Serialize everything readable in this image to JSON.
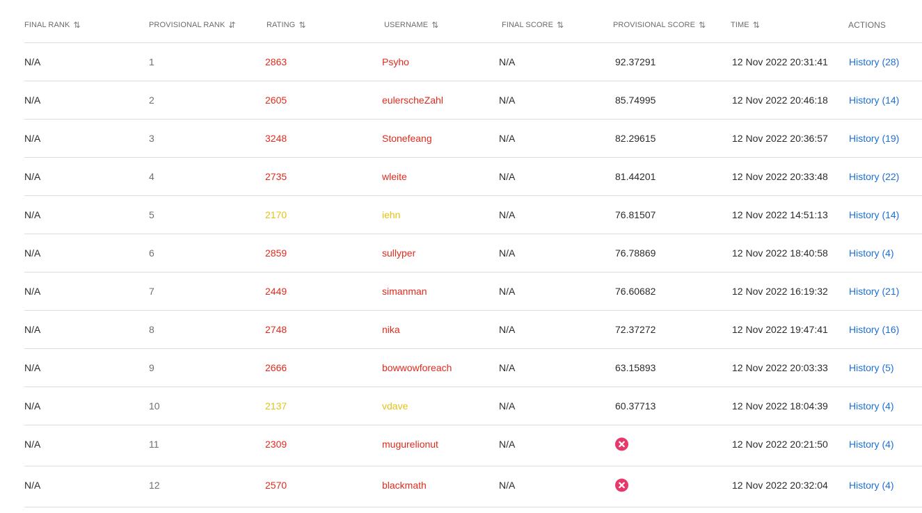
{
  "columns": {
    "final_rank": "FINAL RANK",
    "provisional_rank": "PROVISIONAL RANK",
    "rating": "RATING",
    "username": "USERNAME",
    "final_score": "FINAL SCORE",
    "provisional_score": "PROVISIONAL SCORE",
    "time": "TIME",
    "actions": "ACTIONS"
  },
  "sort_icons": {
    "default": "⇅",
    "provisional_rank": "⇵"
  },
  "colors": {
    "red_rating": "#e02a1e",
    "yellow_rating": "#e5c117",
    "link": "#1d6fd6",
    "error_icon": "#e6386a"
  },
  "rows": [
    {
      "final_rank": "N/A",
      "provisional_rank": "1",
      "rating": "2863",
      "rating_color": "red",
      "username": "Psyho",
      "final_score": "N/A",
      "provisional_score": "92.37291",
      "time": "12 Nov 2022 20:31:41",
      "action": "History (28)"
    },
    {
      "final_rank": "N/A",
      "provisional_rank": "2",
      "rating": "2605",
      "rating_color": "red",
      "username": "eulerscheZahl",
      "final_score": "N/A",
      "provisional_score": "85.74995",
      "time": "12 Nov 2022 20:46:18",
      "action": "History (14)"
    },
    {
      "final_rank": "N/A",
      "provisional_rank": "3",
      "rating": "3248",
      "rating_color": "red",
      "username": "Stonefeang",
      "final_score": "N/A",
      "provisional_score": "82.29615",
      "time": "12 Nov 2022 20:36:57",
      "action": "History (19)"
    },
    {
      "final_rank": "N/A",
      "provisional_rank": "4",
      "rating": "2735",
      "rating_color": "red",
      "username": "wleite",
      "final_score": "N/A",
      "provisional_score": "81.44201",
      "time": "12 Nov 2022 20:33:48",
      "action": "History (22)"
    },
    {
      "final_rank": "N/A",
      "provisional_rank": "5",
      "rating": "2170",
      "rating_color": "yellow",
      "username": "iehn",
      "final_score": "N/A",
      "provisional_score": "76.81507",
      "time": "12 Nov 2022 14:51:13",
      "action": "History (14)"
    },
    {
      "final_rank": "N/A",
      "provisional_rank": "6",
      "rating": "2859",
      "rating_color": "red",
      "username": "sullyper",
      "final_score": "N/A",
      "provisional_score": "76.78869",
      "time": "12 Nov 2022 18:40:58",
      "action": "History (4)"
    },
    {
      "final_rank": "N/A",
      "provisional_rank": "7",
      "rating": "2449",
      "rating_color": "red",
      "username": "simanman",
      "final_score": "N/A",
      "provisional_score": "76.60682",
      "time": "12 Nov 2022 16:19:32",
      "action": "History (21)"
    },
    {
      "final_rank": "N/A",
      "provisional_rank": "8",
      "rating": "2748",
      "rating_color": "red",
      "username": "nika",
      "final_score": "N/A",
      "provisional_score": "72.37272",
      "time": "12 Nov 2022 19:47:41",
      "action": "History (16)"
    },
    {
      "final_rank": "N/A",
      "provisional_rank": "9",
      "rating": "2666",
      "rating_color": "red",
      "username": "bowwowforeach",
      "final_score": "N/A",
      "provisional_score": "63.15893",
      "time": "12 Nov 2022 20:03:33",
      "action": "History (5)"
    },
    {
      "final_rank": "N/A",
      "provisional_rank": "10",
      "rating": "2137",
      "rating_color": "yellow",
      "username": "vdave",
      "final_score": "N/A",
      "provisional_score": "60.37713",
      "time": "12 Nov 2022 18:04:39",
      "action": "History (4)"
    },
    {
      "final_rank": "N/A",
      "provisional_rank": "11",
      "rating": "2309",
      "rating_color": "red",
      "username": "mugurelionut",
      "final_score": "N/A",
      "provisional_score": null,
      "provisional_score_icon": "error-x-icon",
      "time": "12 Nov 2022 20:21:50",
      "action": "History (4)"
    },
    {
      "final_rank": "N/A",
      "provisional_rank": "12",
      "rating": "2570",
      "rating_color": "red",
      "username": "blackmath",
      "final_score": "N/A",
      "provisional_score": null,
      "provisional_score_icon": "error-x-icon",
      "time": "12 Nov 2022 20:32:04",
      "action": "History (4)"
    }
  ]
}
